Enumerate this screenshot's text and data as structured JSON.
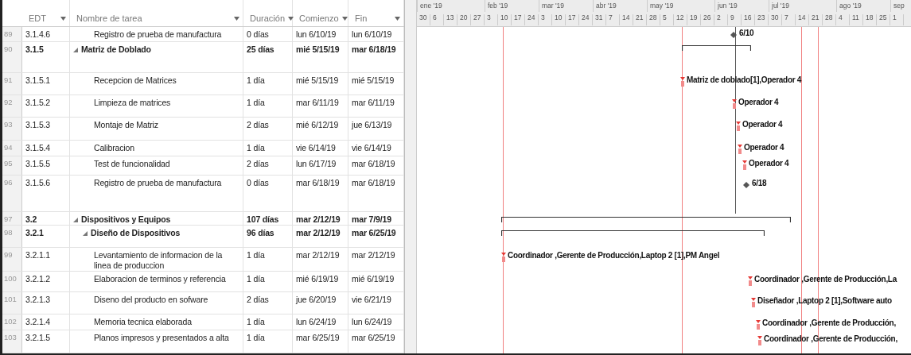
{
  "table": {
    "columns": [
      {
        "label": "EDT"
      },
      {
        "label": "Nombre de tarea"
      },
      {
        "label": "Duración"
      },
      {
        "label": "Comienzo"
      },
      {
        "label": "Fin"
      }
    ],
    "rows": [
      {
        "id": "89",
        "edt": "3.1.4.6",
        "name": "Registro de prueba de manufactura",
        "duration": "0 días",
        "start": "lun 6/10/19",
        "finish": "lun 6/10/19",
        "kind": "milestone",
        "gantt_label": "6/10"
      },
      {
        "id": "90",
        "edt": "3.1.5",
        "name": "Matriz de Doblado",
        "duration": "25 días",
        "start": "mié 5/15/19",
        "finish": "mar 6/18/19",
        "kind": "summary",
        "expanded": true,
        "children": [
          {
            "id": "91",
            "edt": "3.1.5.1",
            "name": "Recepcion de Matrices",
            "duration": "1 día",
            "start": "mié 5/15/19",
            "finish": "mié 5/15/19",
            "kind": "task",
            "gantt_label": "Matriz de doblado[1],Operador 4"
          },
          {
            "id": "92",
            "edt": "3.1.5.2",
            "name": "Limpieza de matrices",
            "duration": "1 día",
            "start": "mar 6/11/19",
            "finish": "mar 6/11/19",
            "kind": "task",
            "gantt_label": "Operador 4"
          },
          {
            "id": "93",
            "edt": "3.1.5.3",
            "name": "Montaje de Matriz",
            "duration": "2 días",
            "start": "mié 6/12/19",
            "finish": "jue 6/13/19",
            "kind": "task",
            "gantt_label": "Operador 4"
          },
          {
            "id": "94",
            "edt": "3.1.5.4",
            "name": "Calibracion",
            "duration": "1 día",
            "start": "vie 6/14/19",
            "finish": "vie 6/14/19",
            "kind": "task",
            "gantt_label": "Operador 4"
          },
          {
            "id": "95",
            "edt": "3.1.5.5",
            "name": "Test de funcionalidad",
            "duration": "2 días",
            "start": "lun 6/17/19",
            "finish": "mar 6/18/19",
            "kind": "task",
            "gantt_label": "Operador 4"
          },
          {
            "id": "96",
            "edt": "3.1.5.6",
            "name": "Registro de prueba de manufactura",
            "duration": "0 días",
            "start": "mar 6/18/19",
            "finish": "mar 6/18/19",
            "kind": "milestone",
            "gantt_label": "6/18"
          }
        ]
      },
      {
        "id": "97",
        "edt": "3.2",
        "name": "Dispositivos y Equipos",
        "duration": "107 días",
        "start": "mar 2/12/19",
        "finish": "mar 7/9/19",
        "kind": "summary",
        "expanded": true,
        "children": [
          {
            "id": "98",
            "edt": "3.2.1",
            "name": "Diseño de Dispositivos",
            "duration": "96 días",
            "start": "mar 2/12/19",
            "finish": "mar 6/25/19",
            "kind": "summary",
            "expanded": true,
            "children": [
              {
                "id": "99",
                "edt": "3.2.1.1",
                "name": "Levantamiento de informacion de la linea de produccion",
                "duration": "1 día",
                "start": "mar 2/12/19",
                "finish": "mar 2/12/19",
                "kind": "task",
                "gantt_label": "Coordinador ,Gerente de Producción,Laptop 2 [1],PM Angel"
              },
              {
                "id": "100",
                "edt": "3.2.1.2",
                "name": "Elaboracion de terminos y referencia",
                "duration": "1 día",
                "start": "mié 6/19/19",
                "finish": "mié 6/19/19",
                "kind": "task",
                "gantt_label": "Coordinador ,Gerente de Producción,La"
              },
              {
                "id": "101",
                "edt": "3.2.1.3",
                "name": "Diseno del producto en sofware",
                "duration": "2 días",
                "start": "jue 6/20/19",
                "finish": "vie 6/21/19",
                "kind": "task",
                "gantt_label": "Diseñador ,Laptop 2 [1],Software auto"
              },
              {
                "id": "102",
                "edt": "3.2.1.4",
                "name": "Memoria tecnica elaborada",
                "duration": "1 día",
                "start": "lun 6/24/19",
                "finish": "lun 6/24/19",
                "kind": "task",
                "gantt_label": "Coordinador ,Gerente de Producción,"
              },
              {
                "id": "103",
                "edt": "3.2.1.5",
                "name": "Planos impresos y presentados a alta",
                "duration": "1 día",
                "start": "mar 6/25/19",
                "finish": "mar 6/25/19",
                "kind": "task",
                "gantt_label": "Coordinador ,Gerente de Producción,"
              }
            ]
          }
        ]
      }
    ]
  },
  "timescale": {
    "months": [
      "ene '19",
      "feb '19",
      "mar '19",
      "abr '19",
      "may '19",
      "jun '19",
      "jul '19",
      "ago '19",
      "sep"
    ],
    "weeks": [
      "30",
      "6",
      "13",
      "20",
      "27",
      "3",
      "10",
      "17",
      "24",
      "3",
      "10",
      "17",
      "24",
      "31",
      "7",
      "14",
      "21",
      "28",
      "5",
      "12",
      "19",
      "26",
      "2",
      "9",
      "16",
      "23",
      "30",
      "7",
      "14",
      "21",
      "28",
      "4",
      "11",
      "18",
      "25",
      "1"
    ]
  }
}
